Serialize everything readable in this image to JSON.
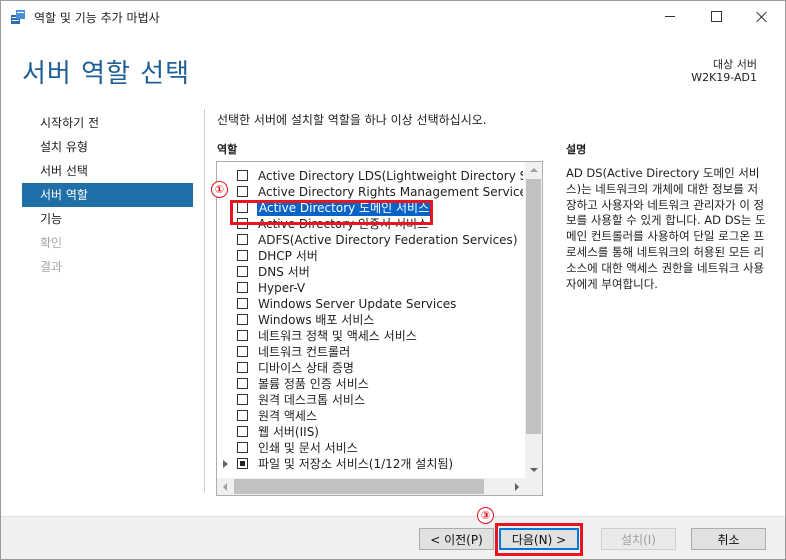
{
  "window": {
    "title": "역할 및 기능 추가 마법사"
  },
  "header": {
    "page_title": "서버 역할 선택",
    "destination_label": "대상 서버",
    "destination_value": "W2K19-AD1"
  },
  "nav": {
    "items": [
      {
        "label": "시작하기 전",
        "state": "normal"
      },
      {
        "label": "설치 유형",
        "state": "normal"
      },
      {
        "label": "서버 선택",
        "state": "normal"
      },
      {
        "label": "서버 역할",
        "state": "active"
      },
      {
        "label": "기능",
        "state": "normal"
      },
      {
        "label": "확인",
        "state": "disabled"
      },
      {
        "label": "결과",
        "state": "disabled"
      }
    ]
  },
  "main": {
    "instruction": "선택한 서버에 설치할 역할을 하나 이상 선택하십시오.",
    "roles_heading": "역할",
    "description_heading": "설명",
    "roles": [
      {
        "label": "Active Directory LDS(Lightweight Directory Services)",
        "checked": false
      },
      {
        "label": "Active Directory Rights Management Services",
        "checked": false
      },
      {
        "label": "Active Directory 도메인 서비스",
        "checked": false,
        "selected": true
      },
      {
        "label": "Active Directory 인증서 서비스",
        "checked": false
      },
      {
        "label": "ADFS(Active Directory Federation Services)",
        "checked": false
      },
      {
        "label": "DHCP 서버",
        "checked": false
      },
      {
        "label": "DNS 서버",
        "checked": false
      },
      {
        "label": "Hyper-V",
        "checked": false
      },
      {
        "label": "Windows Server Update Services",
        "checked": false
      },
      {
        "label": "Windows 배포 서비스",
        "checked": false
      },
      {
        "label": "네트워크 정책 및 액세스 서비스",
        "checked": false
      },
      {
        "label": "네트워크 컨트롤러",
        "checked": false
      },
      {
        "label": "디바이스 상태 증명",
        "checked": false
      },
      {
        "label": "볼륨 정품 인증 서비스",
        "checked": false
      },
      {
        "label": "원격 데스크톱 서비스",
        "checked": false
      },
      {
        "label": "원격 액세스",
        "checked": false
      },
      {
        "label": "웹 서버(IIS)",
        "checked": false
      },
      {
        "label": "인쇄 및 문서 서비스",
        "checked": false
      },
      {
        "label": "파일 및 저장소 서비스(1/12개 설치됨)",
        "checked": "partial",
        "expandable": true
      }
    ],
    "description": "AD DS(Active Directory 도메인 서비스)는 네트워크의 개체에 대한 정보를 저장하고 사용자와 네트워크 관리자가 이 정보를 사용할 수 있게 합니다. AD DS는 도메인 컨트롤러를 사용하여 단일 로그온 프로세스를 통해 네트워크의 허용된 모든 리소스에 대한 액세스 권한을 네트워크 사용자에게 부여합니다."
  },
  "annotations": {
    "marker_1": "①",
    "marker_3": "③",
    "color": "#e8141e"
  },
  "footer": {
    "prev_label": "< 이전(P)",
    "next_label": "다음(N) >",
    "install_label": "설치(I)",
    "cancel_label": "취소"
  },
  "colors": {
    "title_blue": "#1f5f95",
    "nav_active": "#1f6fa8",
    "selection": "#0a64c8"
  }
}
